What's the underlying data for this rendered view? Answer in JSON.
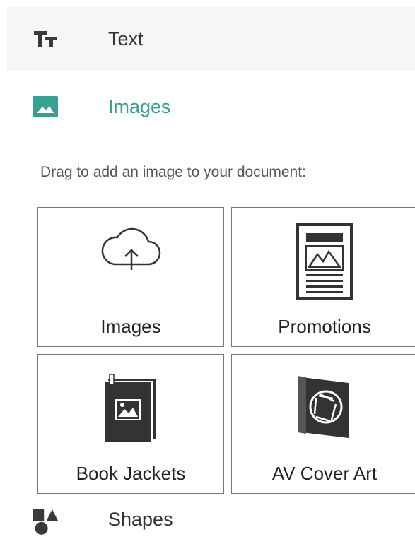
{
  "menu": {
    "text_label": "Text",
    "text_icon": "text-format-icon",
    "images_label": "Images",
    "images_icon": "image-icon",
    "shapes_label": "Shapes",
    "shapes_icon": "shapes-icon",
    "accent_color": "#3a9e92"
  },
  "images_panel": {
    "hint": "Drag to add an image to your document:",
    "tiles": [
      {
        "label": "Images",
        "icon": "cloud-upload-icon"
      },
      {
        "label": "Promotions",
        "icon": "poster-icon"
      },
      {
        "label": "Book Jackets",
        "icon": "book-jacket-icon"
      },
      {
        "label": "AV Cover Art",
        "icon": "av-cover-art-icon"
      }
    ]
  }
}
